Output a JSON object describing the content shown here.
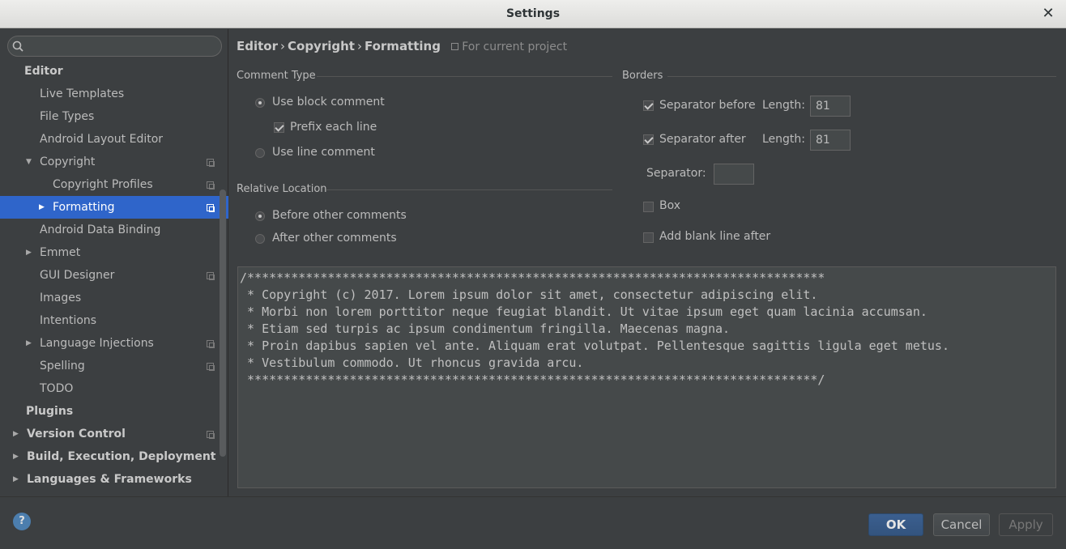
{
  "window": {
    "title": "Settings",
    "close_glyph": "✕"
  },
  "search": {
    "placeholder": "",
    "value": ""
  },
  "sidebar": {
    "items": [
      {
        "label": "Editor",
        "level": 0,
        "bold": true
      },
      {
        "label": "Live Templates",
        "level": 1
      },
      {
        "label": "File Types",
        "level": 1
      },
      {
        "label": "Android Layout Editor",
        "level": 1
      },
      {
        "label": "Copyright",
        "level": 1,
        "expanded": true,
        "project_icon": true
      },
      {
        "label": "Copyright Profiles",
        "level": 2,
        "project_icon": true
      },
      {
        "label": "Formatting",
        "level": 2,
        "selected": true,
        "collapsed_arrow": true,
        "project_icon": true
      },
      {
        "label": "Android Data Binding",
        "level": 1
      },
      {
        "label": "Emmet",
        "level": 1,
        "collapsed_arrow": true
      },
      {
        "label": "GUI Designer",
        "level": 1,
        "project_icon": true
      },
      {
        "label": "Images",
        "level": 1
      },
      {
        "label": "Intentions",
        "level": 1
      },
      {
        "label": "Language Injections",
        "level": 1,
        "collapsed_arrow": true,
        "project_icon": true
      },
      {
        "label": "Spelling",
        "level": 1,
        "project_icon": true
      },
      {
        "label": "TODO",
        "level": 1
      },
      {
        "label": "Plugins",
        "level": 0,
        "bold": true
      },
      {
        "label": "Version Control",
        "level": 0,
        "bold": true,
        "collapsed_arrow": true,
        "project_icon": true
      },
      {
        "label": "Build, Execution, Deployment",
        "level": 0,
        "bold": true,
        "collapsed_arrow": true
      },
      {
        "label": "Languages & Frameworks",
        "level": 0,
        "bold": true,
        "collapsed_arrow": true
      }
    ]
  },
  "breadcrumb": {
    "parts": [
      "Editor",
      "Copyright",
      "Formatting"
    ],
    "separator": "›",
    "scope": "For current project"
  },
  "comment_type": {
    "title": "Comment Type",
    "use_block": {
      "label": "Use block comment",
      "selected": true
    },
    "prefix_each_line": {
      "label": "Prefix each line",
      "checked": true
    },
    "use_line": {
      "label": "Use line comment",
      "selected": false
    }
  },
  "relative_location": {
    "title": "Relative Location",
    "before": {
      "label": "Before other comments",
      "selected": true
    },
    "after": {
      "label": "After other comments",
      "selected": false
    }
  },
  "borders": {
    "title": "Borders",
    "separator_before": {
      "label": "Separator before",
      "checked": true,
      "length_label": "Length:",
      "length": "81"
    },
    "separator_after": {
      "label": "Separator after",
      "checked": true,
      "length_label": "Length:",
      "length": "81"
    },
    "separator": {
      "label": "Separator:",
      "value": ""
    },
    "box": {
      "label": "Box",
      "checked": false
    },
    "blank_line_after": {
      "label": "Add blank line after",
      "checked": false
    }
  },
  "preview": {
    "text": "/*******************************************************************************\n * Copyright (c) 2017. Lorem ipsum dolor sit amet, consectetur adipiscing elit.\n * Morbi non lorem porttitor neque feugiat blandit. Ut vitae ipsum eget quam lacinia accumsan.\n * Etiam sed turpis ac ipsum condimentum fringilla. Maecenas magna.\n * Proin dapibus sapien vel ante. Aliquam erat volutpat. Pellentesque sagittis ligula eget metus.\n * Vestibulum commodo. Ut rhoncus gravida arcu.\n ******************************************************************************/"
  },
  "buttons": {
    "help": "?",
    "ok": "OK",
    "cancel": "Cancel",
    "apply": "Apply"
  }
}
